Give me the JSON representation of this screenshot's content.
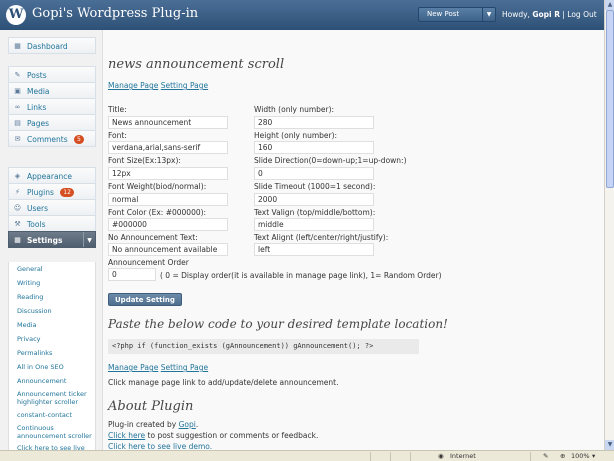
{
  "header": {
    "logo": "W",
    "site_title": "Gopi's Wordpress Plug-in",
    "new_post": "New Post",
    "howdy": "Howdy,",
    "user": "Gopi R",
    "separator": "|",
    "logout": "Log Out"
  },
  "sidebar": {
    "dashboard": "Dashboard",
    "posts": "Posts",
    "media": "Media",
    "links": "Links",
    "pages": "Pages",
    "comments": "Comments",
    "comments_badge": "5",
    "appearance": "Appearance",
    "plugins": "Plugins",
    "plugins_badge": "12",
    "users": "Users",
    "tools": "Tools",
    "settings": "Settings",
    "submenu": [
      "General",
      "Writing",
      "Reading",
      "Discussion",
      "Media",
      "Privacy",
      "Permalinks",
      "All in One SEO",
      "Announcement",
      "Announcement ticker highlighter scroller",
      "constant-contact",
      "Continuous announcement scroller",
      "Click here to see live demo"
    ]
  },
  "main": {
    "title": "news announcement scroll",
    "manage_page": "Manage Page",
    "setting_page": "Setting Page",
    "form": {
      "title_label": "Title:",
      "title_value": "News announcement",
      "font_label": "Font:",
      "font_value": "verdana,arial,sans-serif",
      "font_size_label": "Font Size(Ex:13px):",
      "font_size_value": "12px",
      "font_weight_label": "Font Weight(biod/normal):",
      "font_weight_value": "normal",
      "font_color_label": "Font Color (Ex: #000000):",
      "font_color_value": "#000000",
      "no_announce_label": "No Announcement Text:",
      "no_announce_value": "No announcement available",
      "order_label": "Announcement Order",
      "order_value": "0",
      "order_note": "( 0 = Display order(it is available in manage page link), 1= Random Order)",
      "width_label": "Width (only number):",
      "width_value": "280",
      "height_label": "Height (only number):",
      "height_value": "160",
      "direction_label": "Slide Direction(0=down-up;1=up-down:)",
      "direction_value": "0",
      "timeout_label": "Slide Timeout (1000=1 second):",
      "timeout_value": "2000",
      "valign_label": "Text Valign (top/middle/bottom):",
      "valign_value": "middle",
      "align_label": "Text Alignt (left/center/right/justify):",
      "align_value": "left",
      "update_button": "Update Setting"
    },
    "paste_heading": "Paste the below code to your desired template location!",
    "code": "<?php if (function_exists (gAnnouncement)) gAnnouncement(); ?>",
    "manage_hint": "Click manage page link to add/update/delete announcement.",
    "about_heading": "About Plugin",
    "created_by": "Plug-in created by",
    "author": "Gopi",
    "click_here": "Click here",
    "suggest_text": "to post suggestion or comments or feedback.",
    "live_demo": "Click here to see live demo."
  },
  "statusbar": {
    "zone": "Internet",
    "zoom": "100%"
  }
}
